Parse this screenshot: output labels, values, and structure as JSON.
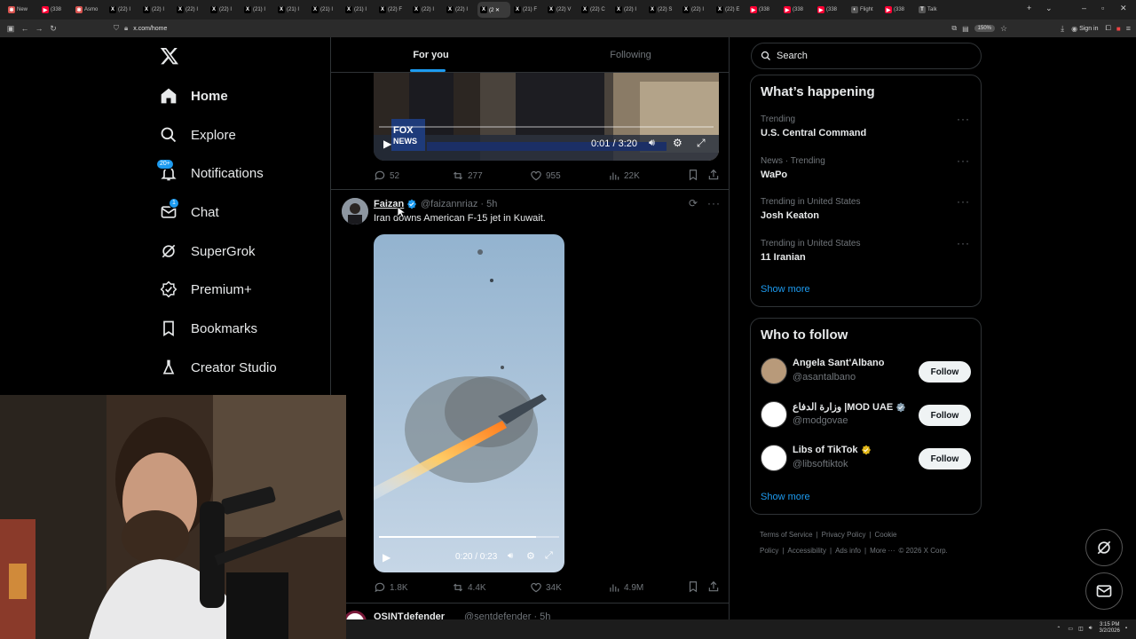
{
  "browser": {
    "tabs": [
      {
        "label": "New",
        "fav": "✱",
        "color": "#d9534f"
      },
      {
        "label": "(338",
        "fav": "▶",
        "color": "#ff0033"
      },
      {
        "label": "Asmo",
        "fav": "✱",
        "color": "#d9534f"
      },
      {
        "label": "(22) I",
        "fav": "X",
        "color": "#000"
      },
      {
        "label": "(22) I",
        "fav": "X",
        "color": "#000"
      },
      {
        "label": "(22) I",
        "fav": "X",
        "color": "#000"
      },
      {
        "label": "(22) I",
        "fav": "X",
        "color": "#000"
      },
      {
        "label": "(21) I",
        "fav": "X",
        "color": "#000"
      },
      {
        "label": "(21) I",
        "fav": "X",
        "color": "#000"
      },
      {
        "label": "(21) I",
        "fav": "X",
        "color": "#000"
      },
      {
        "label": "(21) I",
        "fav": "X",
        "color": "#000"
      },
      {
        "label": "(22) F",
        "fav": "X",
        "color": "#000"
      },
      {
        "label": "(22) I",
        "fav": "X",
        "color": "#000"
      },
      {
        "label": "(22) I",
        "fav": "X",
        "color": "#000"
      },
      {
        "label": "(2 ✕",
        "fav": "X",
        "color": "#000",
        "active": true
      },
      {
        "label": "(21) F",
        "fav": "X",
        "color": "#000"
      },
      {
        "label": "(22) V",
        "fav": "X",
        "color": "#000"
      },
      {
        "label": "(22) C",
        "fav": "X",
        "color": "#000"
      },
      {
        "label": "(22) I",
        "fav": "X",
        "color": "#000"
      },
      {
        "label": "(22) S",
        "fav": "X",
        "color": "#000"
      },
      {
        "label": "(22) I",
        "fav": "X",
        "color": "#000"
      },
      {
        "label": "(22) E",
        "fav": "X",
        "color": "#000"
      },
      {
        "label": "(338",
        "fav": "▶",
        "color": "#ff0033"
      },
      {
        "label": "(338",
        "fav": "▶",
        "color": "#ff0033"
      },
      {
        "label": "(338",
        "fav": "▶",
        "color": "#ff0033"
      },
      {
        "label": "Flight",
        "fav": "◐",
        "color": "#555"
      },
      {
        "label": "(338",
        "fav": "▶",
        "color": "#ff0033"
      },
      {
        "label": "Talk",
        "fav": "T",
        "color": "#555"
      }
    ],
    "url": "x.com/home",
    "zoom": "150%",
    "signin_label": "Sign in"
  },
  "sidebar": {
    "logo": "X",
    "items": [
      {
        "label": "Home",
        "icon": "home-icon",
        "active": true
      },
      {
        "label": "Explore",
        "icon": "search-icon"
      },
      {
        "label": "Notifications",
        "icon": "bell-icon",
        "badge": "20+"
      },
      {
        "label": "Chat",
        "icon": "mail-icon",
        "badge": "1"
      },
      {
        "label": "SuperGrok",
        "icon": "grok-icon"
      },
      {
        "label": "Premium+",
        "icon": "verified-icon"
      },
      {
        "label": "Bookmarks",
        "icon": "bookmark-icon"
      },
      {
        "label": "Creator Studio",
        "icon": "creator-icon"
      }
    ]
  },
  "feed": {
    "tabs": {
      "for_you": "For you",
      "following": "Following"
    },
    "post1": {
      "video_time": "0:01 / 3:20",
      "replies": "52",
      "reposts": "277",
      "likes": "955",
      "views": "22K"
    },
    "post2": {
      "name": "Faizan",
      "handle": "@faizannriaz · 5h",
      "text": "Iran downs American F-15 jet in Kuwait.",
      "video_time": "0:20 / 0:23",
      "video_progress": 0.87,
      "replies": "1.8K",
      "reposts": "4.4K",
      "likes": "34K",
      "views": "4.9M"
    },
    "post3": {
      "name": "OSINTdefender",
      "handle": "@sentdefender · 5h"
    }
  },
  "right": {
    "search_placeholder": "Search",
    "happening": {
      "title": "What’s happening",
      "trends": [
        {
          "meta": "Trending",
          "name": "U.S. Central Command"
        },
        {
          "meta": "News · Trending",
          "name": "WaPo"
        },
        {
          "meta": "Trending in United States",
          "name": "Josh Keaton"
        },
        {
          "meta": "Trending in United States",
          "name": "11 Iranian"
        }
      ],
      "show_more": "Show more"
    },
    "who_to_follow": {
      "title": "Who to follow",
      "accounts": [
        {
          "name": "Angela Sant'Albano",
          "handle": "@asantalbano",
          "verified": false,
          "avatar_color": "#b89a7a"
        },
        {
          "name": "وزارة الدفاع |MOD UAE",
          "handle": "@modgovae",
          "verified": "grey",
          "avatar_color": "#ffffff"
        },
        {
          "name": "Libs of TikTok",
          "handle": "@libsoftiktok",
          "verified": "gold",
          "avatar_color": "#ffffff"
        }
      ],
      "follow_label": "Follow",
      "show_more": "Show more"
    },
    "footer": [
      "Terms of Service",
      "|",
      "Privacy Policy",
      "|",
      "Cookie Policy",
      "|",
      "Accessibility",
      "|",
      "Ads info",
      "|",
      "More ···",
      "© 2026 X Corp."
    ]
  },
  "taskbar": {
    "time": "3:15 PM",
    "date": "3/2/2026"
  },
  "colors": {
    "accent": "#1d9bf0",
    "border": "#2f3336",
    "muted": "#71767b",
    "text": "#e7e9ea"
  }
}
